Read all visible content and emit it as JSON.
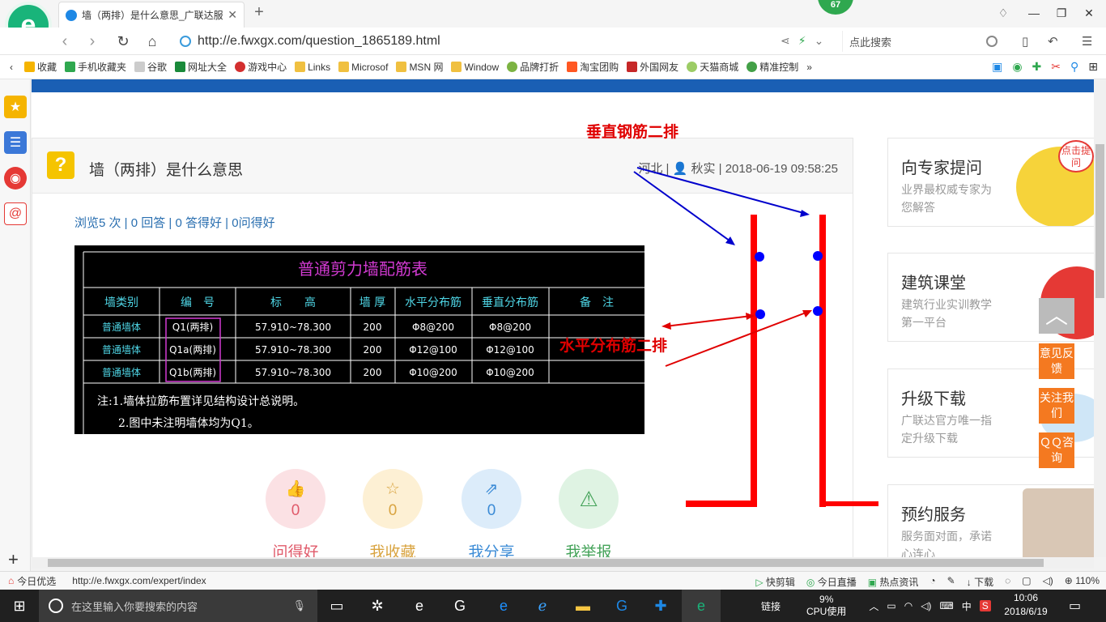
{
  "browser": {
    "tab_title": "墙（两排）是什么意思_广联达服",
    "url": "http://e.fwxgx.com/question_1865189.html",
    "search_placeholder": "点此搜索",
    "notification_badge": "67"
  },
  "bookmarks": [
    {
      "label": "收藏",
      "icon_color": "#f5b400"
    },
    {
      "label": "手机收藏夹",
      "icon_color": "#2fa84f"
    },
    {
      "label": "谷歌",
      "icon_color": "#cccccc"
    },
    {
      "label": "网址大全",
      "icon_color": "#1a8a3a"
    },
    {
      "label": "游戏中心",
      "icon_color": "#d32f2f"
    },
    {
      "label": "Links",
      "icon_color": "#f0c040"
    },
    {
      "label": "Microsof",
      "icon_color": "#f0c040"
    },
    {
      "label": "MSN 网",
      "icon_color": "#f0c040"
    },
    {
      "label": "Window",
      "icon_color": "#f0c040"
    },
    {
      "label": "品牌打折",
      "icon_color": "#7cb342"
    },
    {
      "label": "淘宝团购",
      "icon_color": "#ff5722"
    },
    {
      "label": "外国网友",
      "icon_color": "#c62828"
    },
    {
      "label": "天猫商城",
      "icon_color": "#9ccc65"
    },
    {
      "label": "精准控制",
      "icon_color": "#43a047"
    }
  ],
  "question": {
    "title": "墙（两排）是什么意思",
    "location": "河北",
    "author": "秋实",
    "datetime": "2018-06-19 09:58:25",
    "stats": {
      "views": "浏览5 次",
      "answers": "0 回答",
      "good_answers": "0 答得好",
      "good_questions": "0问得好"
    }
  },
  "cad_table": {
    "title": "普通剪力墙配筋表",
    "headers": [
      "墙类别",
      "编　号",
      "标　　高",
      "墙 厚",
      "水平分布筋",
      "垂直分布筋",
      "备　注"
    ],
    "rows": [
      [
        "普通墙体",
        "Q1(两排)",
        "57.910~78.300",
        "200",
        "Φ8@200",
        "Φ8@200",
        ""
      ],
      [
        "普通墙体",
        "Q1a(两排)",
        "57.910~78.300",
        "200",
        "Φ12@100",
        "Φ12@100",
        ""
      ],
      [
        "普通墙体",
        "Q1b(两排)",
        "57.910~78.300",
        "200",
        "Φ10@200",
        "Φ10@200",
        ""
      ]
    ],
    "notes": [
      "注:1.墙体拉筋布置详见结构设计总说明。",
      "2.图中未注明墙体均为Q1。"
    ]
  },
  "annotations": {
    "vertical_label": "垂直钢筋二排",
    "horizontal_label": "水平分布筋二排"
  },
  "actions": [
    {
      "label": "问得好",
      "count": "0",
      "icon": "thumbs-up-icon",
      "bg": "#fbe1e4",
      "fg": "#e05a6a"
    },
    {
      "label": "我收藏",
      "count": "0",
      "icon": "star-icon",
      "bg": "#fdf0d4",
      "fg": "#d9a441"
    },
    {
      "label": "我分享",
      "count": "0",
      "icon": "share-icon",
      "bg": "#dcecfa",
      "fg": "#3b8bd6"
    },
    {
      "label": "我举报",
      "count": "",
      "icon": "warning-icon",
      "bg": "#dff3e3",
      "fg": "#45a35a"
    }
  ],
  "ads": [
    {
      "title": "向专家提问",
      "sub": "业界最权威专家为您解答",
      "art": "#f6d33a"
    },
    {
      "title": "建筑课堂",
      "sub": "建筑行业实训教学第一平台",
      "art": "#e53935"
    },
    {
      "title": "升级下载",
      "sub": "广联达官方唯一指定升级下载",
      "art": "#cfe6f7"
    },
    {
      "title": "预约服务",
      "sub": "服务面对面，承诺心连心",
      "art": "#d9c7b5"
    }
  ],
  "ad_bubble": "点击提问",
  "float_tools": [
    "意见反馈",
    "关注我们",
    "ＱＱ咨询"
  ],
  "statusbar": {
    "left_label": "今日优选",
    "url": "http://e.fwxgx.com/expert/index",
    "items": [
      "快剪辑",
      "今日直播",
      "热点资讯",
      "下载",
      "110%"
    ]
  },
  "taskbar": {
    "search_placeholder": "在这里输入你要搜索的内容",
    "link_label": "链接",
    "cpu_percent": "9%",
    "cpu_label": "CPU使用",
    "ime": "中",
    "time": "10:06",
    "date": "2018/6/19"
  }
}
